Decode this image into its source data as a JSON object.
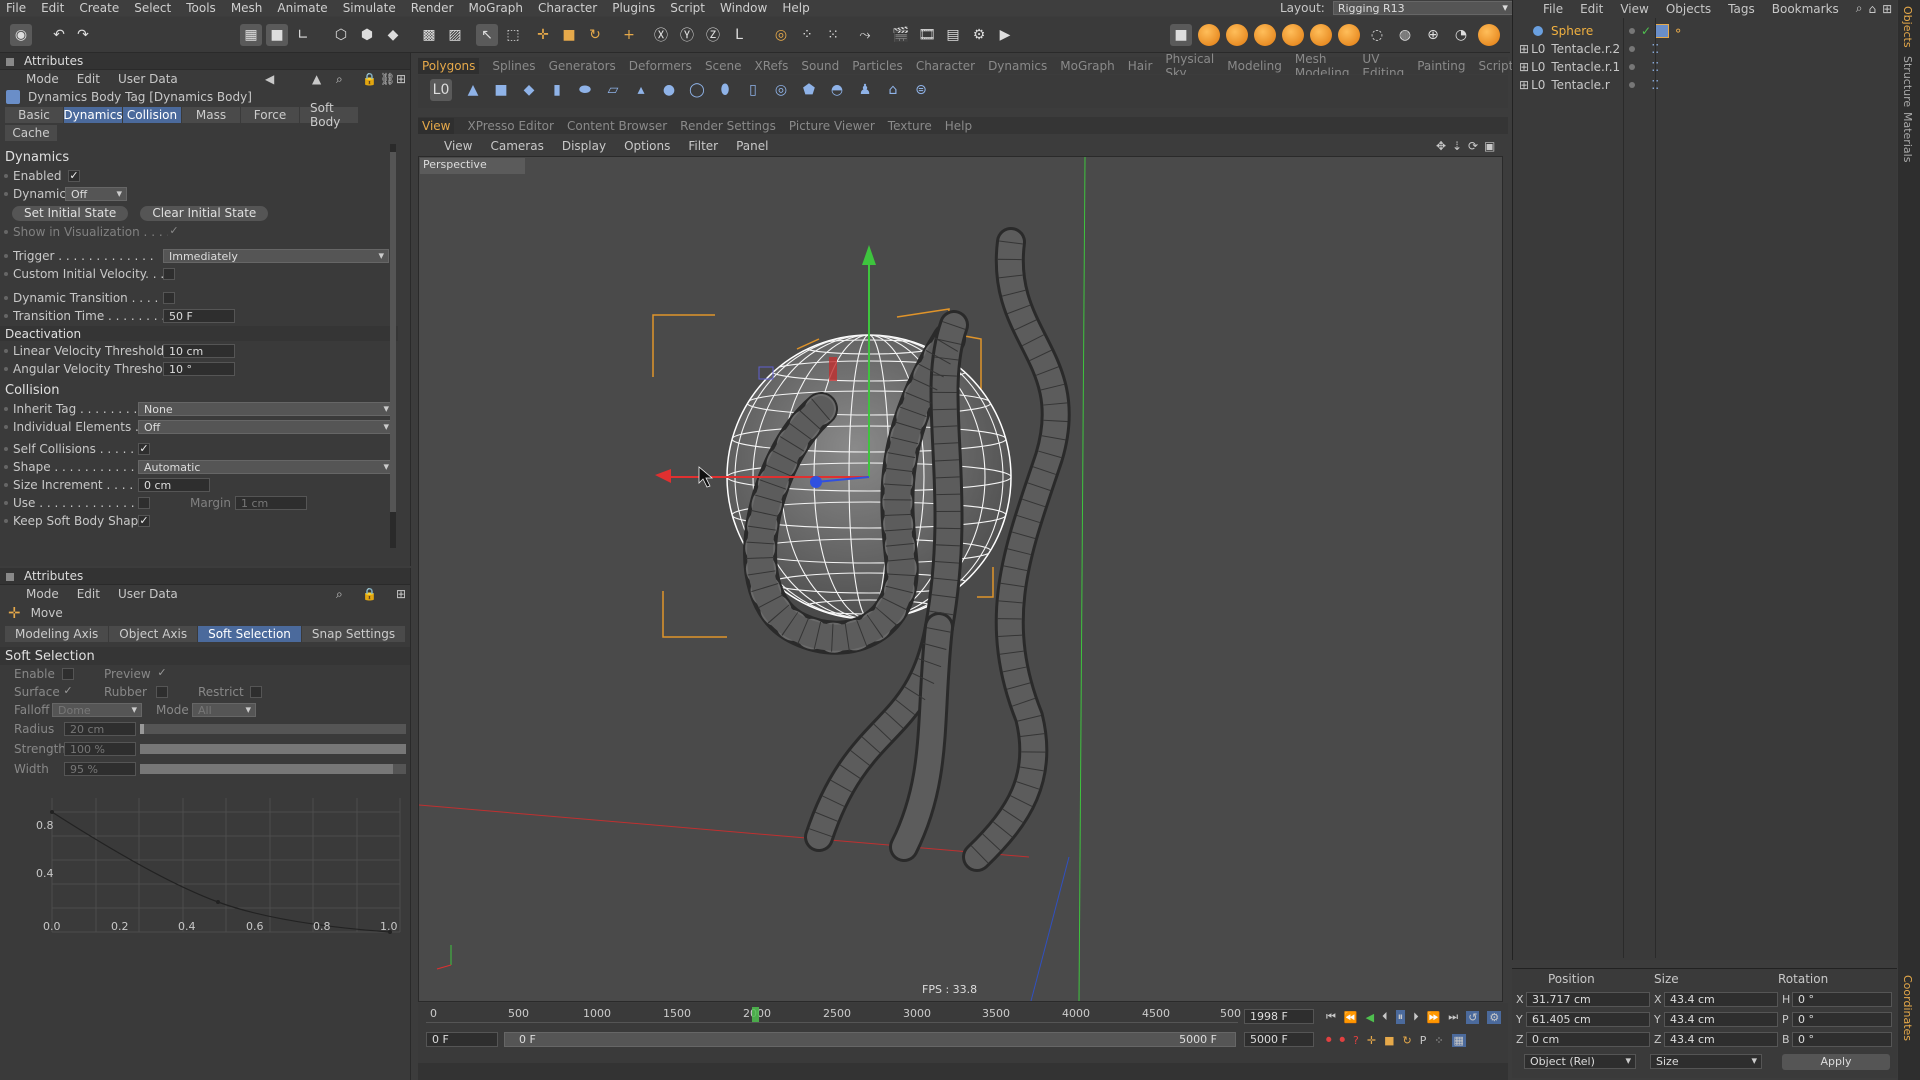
{
  "menubar": {
    "items": [
      "File",
      "Edit",
      "Create",
      "Select",
      "Tools",
      "Mesh",
      "Animate",
      "Simulate",
      "Render",
      "MoGraph",
      "Character",
      "Plugins",
      "Script",
      "Window",
      "Help"
    ],
    "layout_label": "Layout:",
    "layout_value": "Rigging R13"
  },
  "attributes_top": {
    "header": "Attributes",
    "menu": [
      "Mode",
      "Edit",
      "User Data"
    ],
    "tag_title": "Dynamics Body Tag [Dynamics Body]",
    "tabs": [
      "Basic",
      "Dynamics",
      "Collision",
      "Mass",
      "Force",
      "Soft Body",
      "Cache"
    ],
    "section_dynamics": "Dynamics",
    "enabled_label": "Enabled",
    "dynamic_label": "Dynamic",
    "dynamic_value": "Off",
    "set_initial_state": "Set Initial State",
    "clear_initial_state": "Clear Initial State",
    "show_in_vis_label": "Show in Visualization . . . . .",
    "trigger_label": "Trigger . . . . . . . . . . . . .",
    "trigger_value": "Immediately",
    "custom_initial_velocity_label": "Custom Initial Velocity. . . .",
    "dynamic_transition_label": "Dynamic Transition . . . . . .",
    "transition_time_label": "Transition Time . . . . . . . .",
    "transition_time_value": "50 F",
    "section_deactivation": "Deactivation",
    "linear_vel_label": "Linear Velocity Threshold",
    "linear_vel_value": "10 cm",
    "angular_vel_label": "Angular Velocity Threshold",
    "angular_vel_value": "10 °",
    "section_collision": "Collision",
    "inherit_tag_label": "Inherit Tag . . . . . . . . .",
    "inherit_tag_value": "None",
    "individual_elements_label": "Individual Elements . .",
    "individual_elements_value": "Off",
    "self_collisions_label": "Self Collisions . . . . . .",
    "shape_label": "Shape . . . . . . . . . . . .",
    "shape_value": "Automatic",
    "size_increment_label": "Size Increment . . . . . .",
    "size_increment_value": "0 cm",
    "use_label": "Use . . . . . . . . . . . . . .",
    "margin_label": "Margin",
    "margin_value": "1 cm",
    "keep_soft_body_label": "Keep Soft Body Shape"
  },
  "attributes_bottom": {
    "header": "Attributes",
    "menu": [
      "Mode",
      "Edit",
      "User Data"
    ],
    "tool_title": "Move",
    "tabs": [
      "Modeling Axis",
      "Object Axis",
      "Soft Selection",
      "Snap Settings"
    ],
    "section": "Soft Selection",
    "enable_label": "Enable",
    "preview_label": "Preview",
    "surface_label": "Surface",
    "rubber_label": "Rubber",
    "restrict_label": "Restrict",
    "falloff_label": "Falloff",
    "falloff_value": "Dome",
    "mode_label": "Mode",
    "mode_value": "All",
    "radius_label": "Radius",
    "radius_value": "20 cm",
    "strength_label": "Strength",
    "strength_value": "100 %",
    "width_label": "Width",
    "width_value": "95 %",
    "graph_x_ticks": [
      "0.0",
      "0.2",
      "0.4",
      "0.6",
      "0.8",
      "1.0"
    ],
    "graph_y_ticks": [
      "0.8",
      "0.4"
    ]
  },
  "viewport": {
    "palette_tabs": [
      "Polygons",
      "Splines",
      "Generators",
      "Deformers",
      "Scene",
      "XRefs",
      "Sound",
      "Particles",
      "Character",
      "Dynamics",
      "MoGraph",
      "Hair",
      "Physical Sky",
      "Modeling",
      "Mesh Modeling",
      "UV Editing",
      "Painting",
      "Script"
    ],
    "panel_tabs": [
      "View",
      "XPresso Editor",
      "Content Browser",
      "Render Settings",
      "Picture Viewer",
      "Texture",
      "Help"
    ],
    "view_menu": [
      "View",
      "Cameras",
      "Display",
      "Options",
      "Filter",
      "Panel"
    ],
    "camera_label": "Perspective",
    "fps": "FPS : 33.8"
  },
  "timeline": {
    "ticks": [
      "0",
      "500",
      "1000",
      "1500",
      "2000",
      "2500",
      "3000",
      "3500",
      "4000",
      "4500",
      "500"
    ],
    "current_frame": "1998 F",
    "start_field": "0 F",
    "range_start": "0 F",
    "range_end": "5000 F",
    "end_field": "5000 F"
  },
  "object_manager": {
    "menu": [
      "File",
      "Edit",
      "View",
      "Objects",
      "Tags",
      "Bookmarks"
    ],
    "objects": [
      "Sphere",
      "Tentacle.r.2",
      "Tentacle.r.1",
      "Tentacle.r"
    ]
  },
  "coordinates": {
    "headers": [
      "Position",
      "Size",
      "Rotation"
    ],
    "pos": {
      "x": "31.717 cm",
      "y": "61.405 cm",
      "z": "0 cm"
    },
    "size": {
      "x": "43.4 cm",
      "y": "43.4 cm",
      "z": "43.4 cm"
    },
    "rot": {
      "h": "0 °",
      "p": "0 °",
      "b": "0 °"
    },
    "axis_labels": [
      "X",
      "Y",
      "Z",
      "X",
      "Y",
      "Z",
      "H",
      "P",
      "B"
    ],
    "mode_value": "Object (Rel)",
    "size_mode_value": "Size",
    "apply_label": "Apply"
  },
  "side_tabs": [
    "Objects",
    "Structure",
    "Materials",
    "Coordinates"
  ],
  "colors": {
    "accent_tab": "#4b6a9c",
    "palette_active": "#e6a94a",
    "bounding_box": "#e0942a",
    "y_axis": "#3ec43e",
    "x_axis": "#e03030",
    "z_axis": "#3050e0"
  }
}
